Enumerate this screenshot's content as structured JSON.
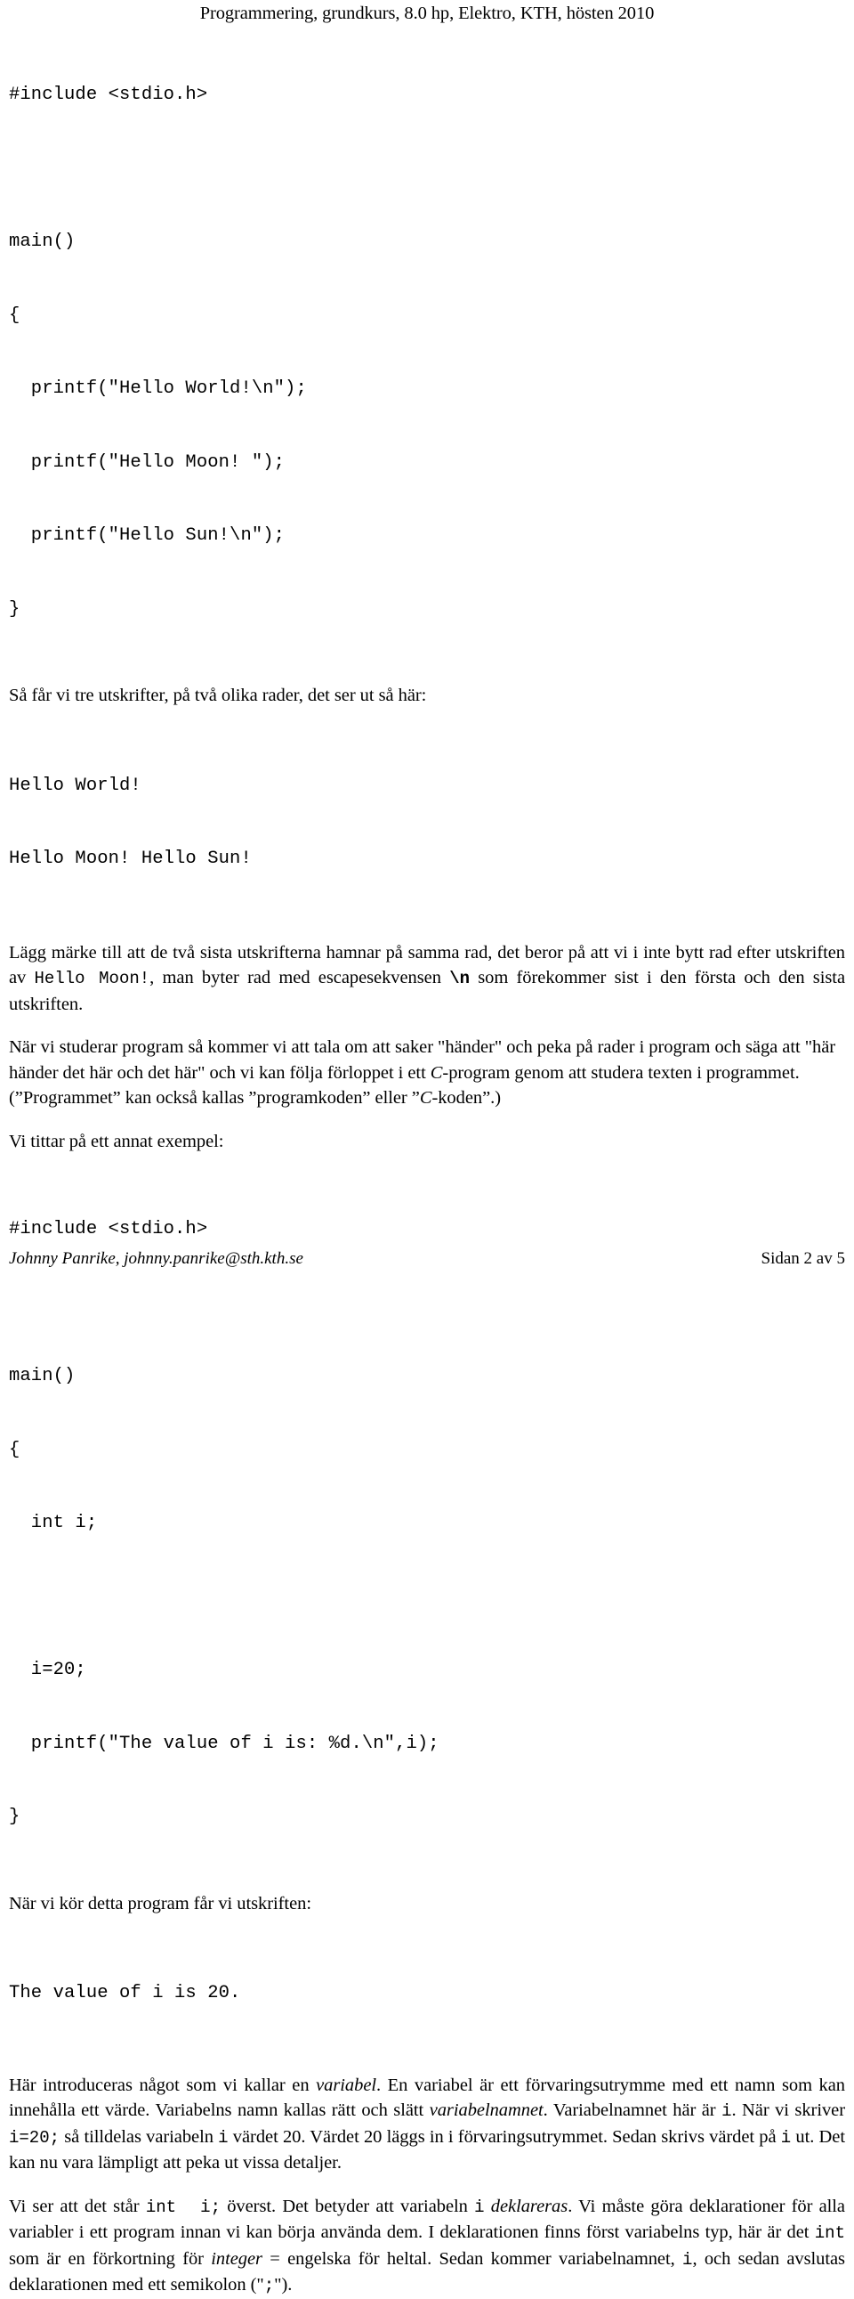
{
  "header": {
    "title": "Programmering, grundkurs, 8.0 hp, Elektro, KTH, hösten 2010"
  },
  "code_block_1": {
    "lines": [
      "#include <stdio.h>",
      "",
      "main()",
      "{",
      "  printf(\"Hello World!\\n\");",
      "  printf(\"Hello Moon! \");",
      "  printf(\"Hello Sun!\\n\");",
      "}"
    ],
    "include_line": "#include <stdio.h>",
    "main_line": "main()",
    "open_brace": "{",
    "printf_world": "  printf(\"Hello World!\\n\");",
    "printf_moon": "  printf(\"Hello Moon! \");",
    "printf_sun": "  printf(\"Hello Sun!\\n\");",
    "close_brace": "}"
  },
  "paragraph_1": {
    "text": "Så får vi tre utskrifter, på två olika rader, det ser ut så här:"
  },
  "output_block_1": {
    "line_1": "Hello World!",
    "line_2": "Hello Moon! Hello Sun!"
  },
  "paragraph_2": {
    "part_1": "Lägg märke till att de två sista utskrifterna hamnar på samma rad, det beror på att vi i inte bytt rad efter utskriften av ",
    "code_1": "Hello Moon!",
    "part_2": ", man byter rad med escapesekvensen ",
    "code_2": "\\n",
    "part_3": " som förekommer sist i den första och den sista utskriften."
  },
  "paragraph_3": {
    "part_1": "När vi studerar program så kommer vi att tala om att saker \"händer\" och peka på rader i program och säga att \"här händer det här och det här\" och vi kan följa förloppet i ett ",
    "ital_1": "C",
    "part_2": "-program genom att studera texten i programmet. (”Programmet” kan också kallas ”programkoden” eller ”",
    "ital_2": "C",
    "part_3": "-koden”.)"
  },
  "paragraph_4": {
    "text": "Vi tittar på ett annat exempel:"
  },
  "code_block_2": {
    "include_line": "#include <stdio.h>",
    "main_line": "main()",
    "open_brace": "{",
    "decl_line": "  int i;",
    "assign_line": "  i=20;",
    "printf_line": "  printf(\"The value of i is: %d.\\n\",i);",
    "close_brace": "}"
  },
  "paragraph_5": {
    "text": "När vi kör detta program får vi utskriften:"
  },
  "output_block_2": {
    "line_1": "The value of i is 20."
  },
  "paragraph_6": {
    "part_1": "Här introduceras något som vi kallar en ",
    "ital_1": "variabel",
    "part_2": ". En variabel är ett förvaringsutrymme med ett namn som kan innehålla ett värde. Variabelns namn kallas rätt och slätt ",
    "ital_2": "variabelnamnet",
    "part_3": ". Variabelnamnet här är ",
    "code_1": "i",
    "part_4": ". När vi skriver ",
    "code_2": "i=20;",
    "part_5": " så tilldelas variabeln ",
    "code_3": "i",
    "part_6": " värdet 20. Värdet 20 läggs in i förvaringsutrymmet. Sedan skrivs värdet på ",
    "code_4": "i",
    "part_7": " ut. Det kan nu vara lämpligt att peka ut vissa detaljer."
  },
  "paragraph_7": {
    "part_1": "Vi ser att det står ",
    "code_1": "int  i;",
    "part_2": " överst. Det betyder att variabeln ",
    "code_2": "i",
    "part_3": " ",
    "ital_1": "deklareras",
    "part_4": ". Vi måste göra deklarationer för alla variabler i ett program innan vi kan börja använda dem. I deklarationen finns först variabelns typ, här är det ",
    "code_3": "int",
    "part_5": " som är en förkortning för ",
    "ital_2": "integer",
    "part_6": " = engelska för heltal. Sedan kommer variabelnamnet, ",
    "code_4": "i",
    "part_7": ", och sedan avslutas deklarationen med ett semikolon (\"",
    "code_5": ";",
    "part_8": "\")."
  },
  "footer": {
    "left": "Johnny Panrike, johnny.panrike@sth.kth.se",
    "right": "Sidan 2 av 5"
  }
}
